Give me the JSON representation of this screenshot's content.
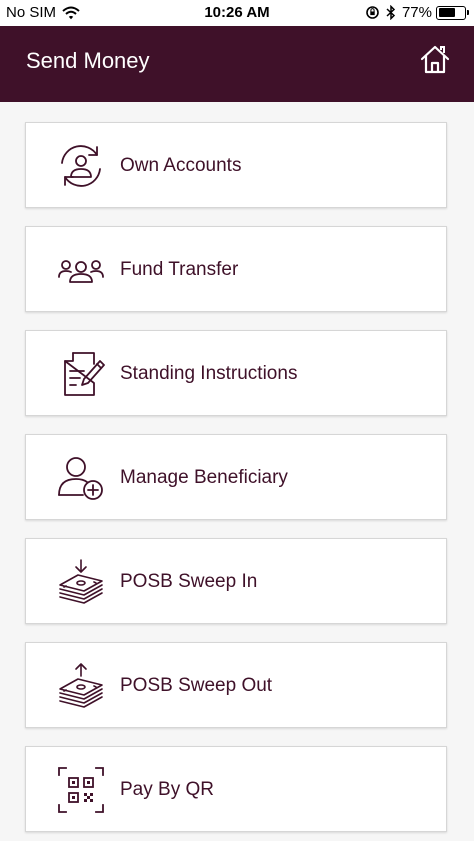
{
  "status_bar": {
    "carrier": "No SIM",
    "time": "10:26 AM",
    "battery_percent": "77%",
    "battery_level": 0.77
  },
  "header": {
    "title": "Send Money",
    "background_color": "#3f1129",
    "home_icon": "home-icon"
  },
  "menu": {
    "accent_color": "#3f1129",
    "items": [
      {
        "label": "Own Accounts",
        "icon": "own-accounts-icon"
      },
      {
        "label": "Fund Transfer",
        "icon": "fund-transfer-icon"
      },
      {
        "label": "Standing Instructions",
        "icon": "standing-instructions-icon"
      },
      {
        "label": "Manage Beneficiary",
        "icon": "manage-beneficiary-icon"
      },
      {
        "label": "POSB Sweep In",
        "icon": "sweep-in-icon"
      },
      {
        "label": "POSB Sweep Out",
        "icon": "sweep-out-icon"
      },
      {
        "label": "Pay By QR",
        "icon": "qr-code-icon"
      }
    ]
  }
}
